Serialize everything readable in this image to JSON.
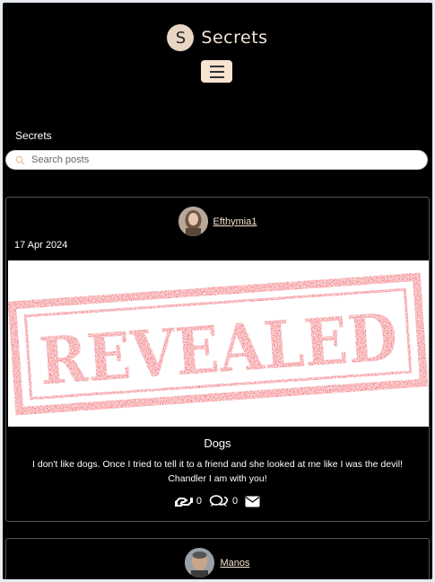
{
  "header": {
    "logo_letter": "S",
    "brand_name": "Secrets"
  },
  "page": {
    "section_title": "Secrets"
  },
  "search": {
    "placeholder": "Search posts"
  },
  "posts": [
    {
      "author": "Efthymia1",
      "date": "17 Apr 2024",
      "image_text": "REVEALED",
      "title": "Dogs",
      "body": "I don't like dogs. Once I tried to tell it to a friend and she looked at me like I was the devil! Chandler I am with you!",
      "likes": "0",
      "comments": "0"
    },
    {
      "author": "Manos"
    }
  ],
  "colors": {
    "accent": "#f8e4d0",
    "stamp_red": "#e8202a",
    "background": "#000000"
  }
}
